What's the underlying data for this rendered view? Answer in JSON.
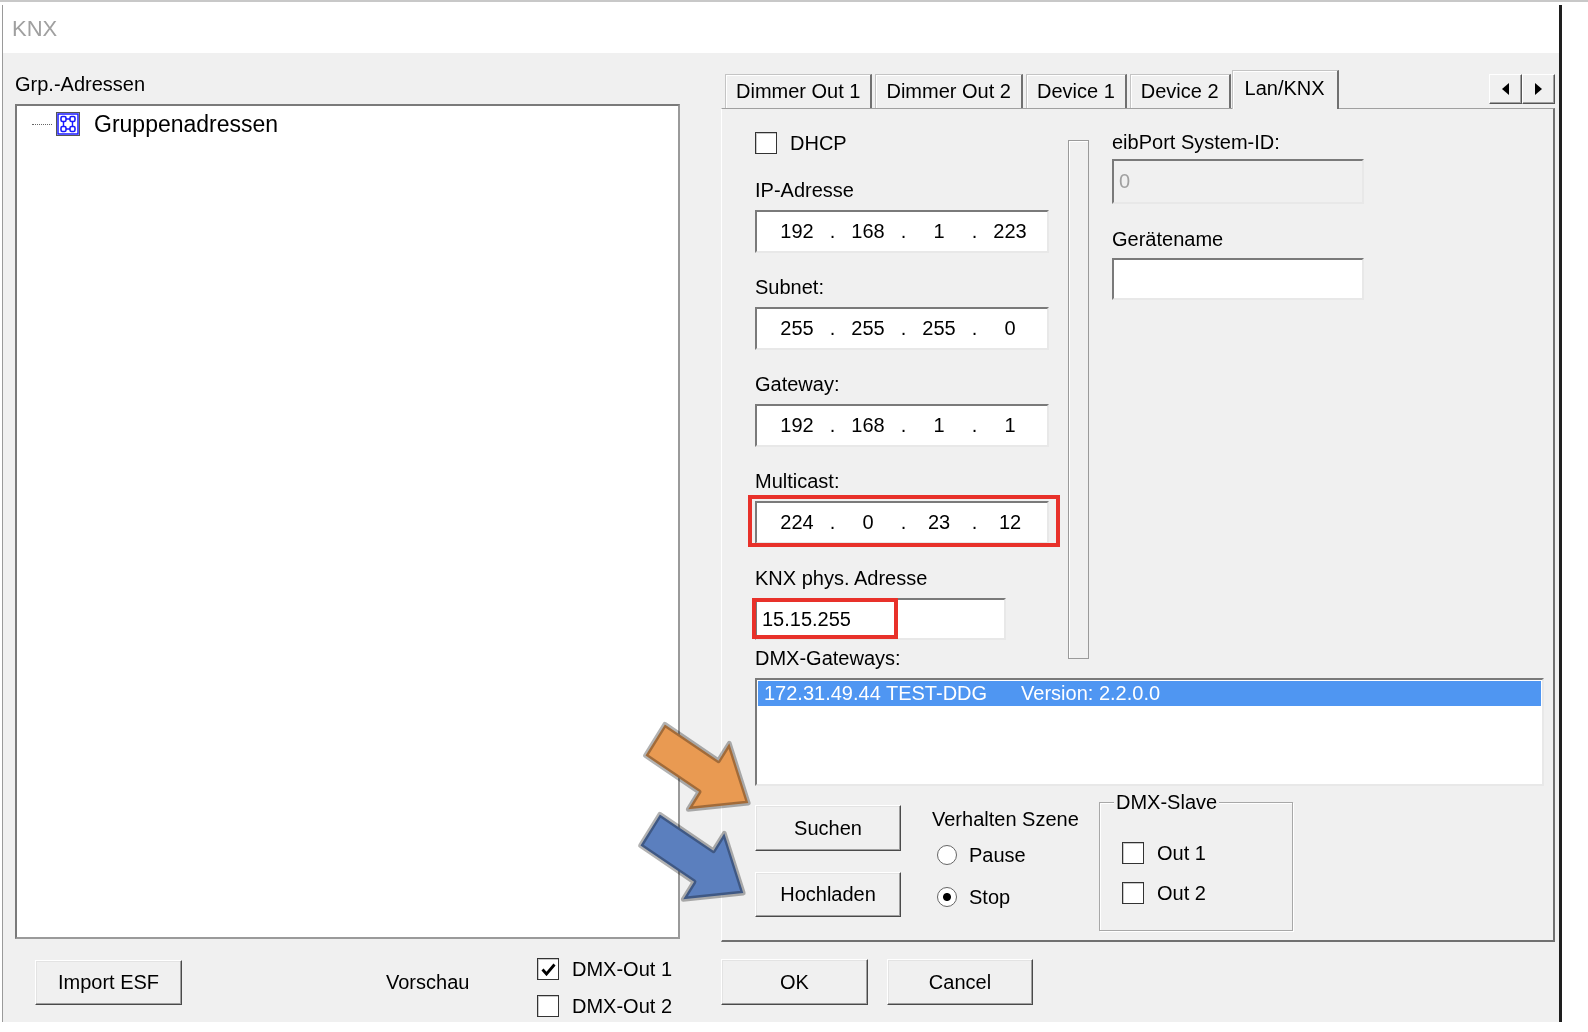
{
  "window": {
    "title": "KNX"
  },
  "group_addresses": {
    "label": "Grp.-Adressen",
    "tree": [
      {
        "label": "Gruppenadressen"
      }
    ]
  },
  "tabs": [
    {
      "label": "Dimmer Out 1",
      "selected": false
    },
    {
      "label": "Dimmer Out 2",
      "selected": false
    },
    {
      "label": "Device 1",
      "selected": false
    },
    {
      "label": "Device 2",
      "selected": false
    },
    {
      "label": "Lan/KNX",
      "selected": true
    }
  ],
  "lan_knx": {
    "dhcp": {
      "label": "DHCP",
      "checked": false
    },
    "octet_separator": ".",
    "ip_fields": [
      {
        "label": "IP-Adresse",
        "octets": [
          "192",
          "168",
          "1",
          "223"
        ],
        "highlighted": false
      },
      {
        "label": "Subnet:",
        "octets": [
          "255",
          "255",
          "255",
          "0"
        ],
        "highlighted": false
      },
      {
        "label": "Gateway:",
        "octets": [
          "192",
          "168",
          "1",
          "1"
        ],
        "highlighted": false
      },
      {
        "label": "Multicast:",
        "octets": [
          "224",
          "0",
          "23",
          "12"
        ],
        "highlighted": true
      }
    ],
    "knx_address": {
      "label": "KNX phys. Adresse",
      "value": "15.15.255",
      "highlighted": true
    },
    "system_id": {
      "label": "eibPort System-ID:",
      "value": "0",
      "disabled": true
    },
    "device_name": {
      "label": "Gerätename"
    },
    "dmx_gateways": {
      "label": "DMX-Gateways:",
      "items": [
        {
          "address": "172.31.49.44 TEST-DDG",
          "version": "Version: 2.2.0.0",
          "selected": true
        }
      ]
    },
    "buttons": [
      "Suchen",
      "Hochladen"
    ],
    "scene_behavior": {
      "label": "Verhalten Szene",
      "options": [
        {
          "label": "Pause",
          "selected": false
        },
        {
          "label": "Stop",
          "selected": true
        }
      ]
    },
    "dmx_slave": {
      "title": "DMX-Slave",
      "outputs": [
        {
          "label": "Out 1",
          "checked": false
        },
        {
          "label": "Out 2",
          "checked": false
        }
      ]
    }
  },
  "import_button": "Import ESF",
  "preview": {
    "label": "Vorschau",
    "outputs": [
      {
        "label": "DMX-Out 1",
        "checked": true
      },
      {
        "label": "DMX-Out 2",
        "checked": false
      }
    ]
  },
  "dialog_buttons": [
    "OK",
    "Cancel"
  ],
  "annotations": [
    {
      "kind": "arrow",
      "color": "#e99a52"
    },
    {
      "kind": "arrow",
      "color": "#5b7fbe"
    }
  ]
}
